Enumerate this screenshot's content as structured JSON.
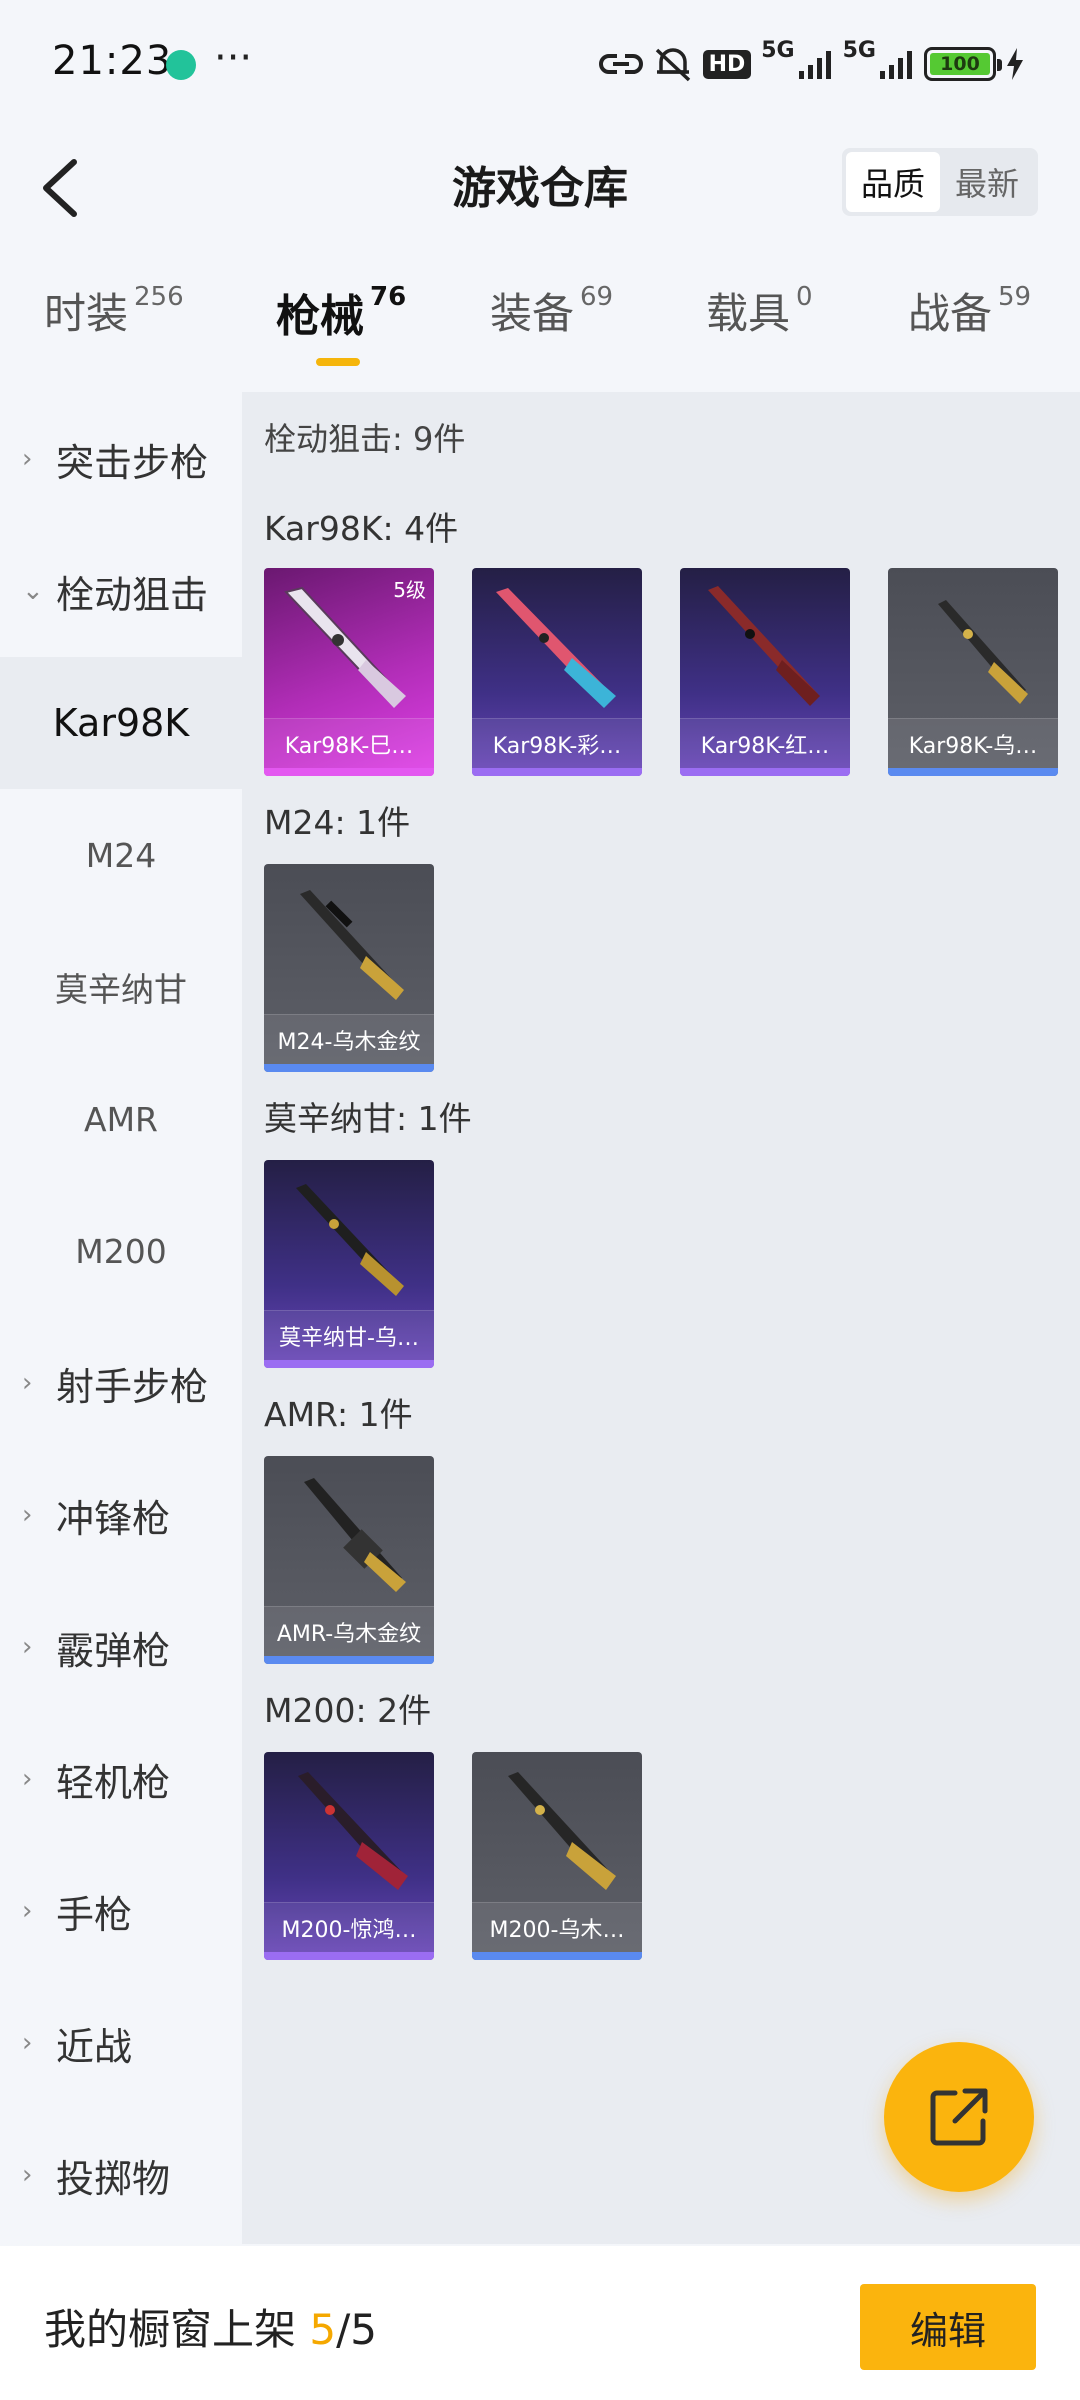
{
  "status_bar": {
    "time": "21:23",
    "more": "···",
    "hd": "HD",
    "net1": "5G",
    "net2": "5G",
    "battery": "100"
  },
  "header": {
    "title": "游戏仓库",
    "sort_quality": "品质",
    "sort_latest": "最新"
  },
  "tabs": [
    {
      "label": "时装",
      "count": "256"
    },
    {
      "label": "枪械",
      "count": "76"
    },
    {
      "label": "装备",
      "count": "69"
    },
    {
      "label": "载具",
      "count": "0"
    },
    {
      "label": "战备",
      "count": "59"
    }
  ],
  "sidebar": {
    "g1": "突击步枪",
    "g2": "栓动狙击",
    "s1": "Kar98K",
    "s2": "M24",
    "s3": "莫辛纳甘",
    "s4": "AMR",
    "s5": "M200",
    "g3": "射手步枪",
    "g4": "冲锋枪",
    "g5": "霰弹枪",
    "g6": "轻机枪",
    "g7": "手枪",
    "g8": "近战",
    "g9": "投掷物"
  },
  "content": {
    "summary": "栓动狙击: 9件",
    "groups": {
      "kar": "Kar98K: 4件",
      "m24": "M24: 1件",
      "mosin": "莫辛纳甘: 1件",
      "amr": "AMR: 1件",
      "m200": "M200: 2件"
    },
    "cards": {
      "c1": {
        "name": "Kar98K-巳…",
        "level": "5级",
        "rarity": "pink"
      },
      "c2": {
        "name": "Kar98K-彩…",
        "rarity": "purple"
      },
      "c3": {
        "name": "Kar98K-红…",
        "rarity": "purple"
      },
      "c4": {
        "name": "Kar98K-乌…",
        "rarity": "gray"
      },
      "c5": {
        "name": "M24-乌木金纹",
        "rarity": "gray"
      },
      "c6": {
        "name": "莫辛纳甘-乌…",
        "rarity": "purple"
      },
      "c7": {
        "name": "AMR-乌木金纹",
        "rarity": "gray"
      },
      "c8": {
        "name": "M200-惊鸿…",
        "rarity": "purple"
      },
      "c9": {
        "name": "M200-乌木…",
        "rarity": "gray"
      }
    }
  },
  "bottom": {
    "label": "我的橱窗上架 ",
    "count": "5",
    "sep": "/",
    "total": "5",
    "edit": "编辑"
  },
  "colors": {
    "accent": "#fbb40d",
    "rarity_pink": "#e358f0",
    "rarity_purple": "#9b6df2",
    "rarity_gray": "#5a8af0"
  }
}
